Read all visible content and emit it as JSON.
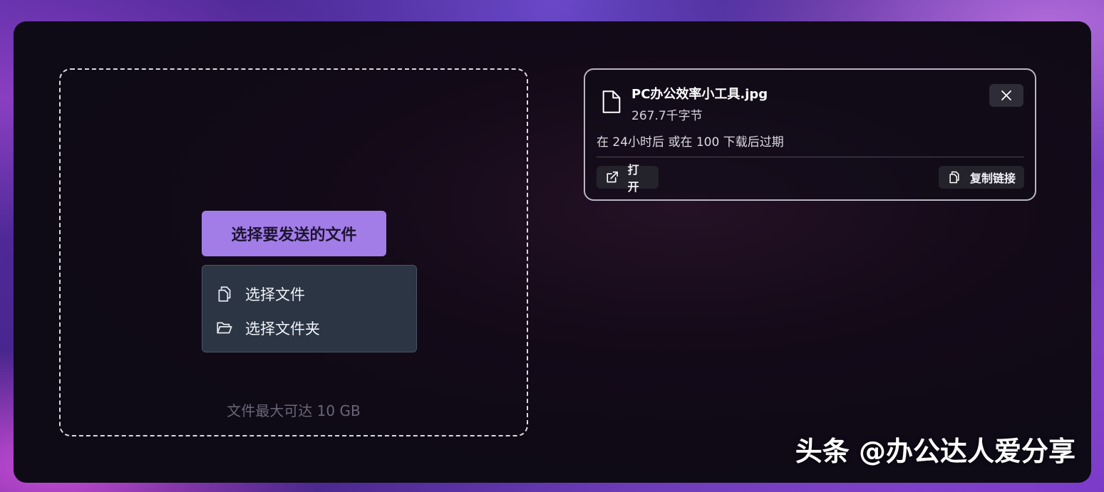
{
  "dropzone": {
    "select_button_label": "选择要发送的文件",
    "menu": [
      {
        "label": "选择文件",
        "icon": "copy-files-icon"
      },
      {
        "label": "选择文件夹",
        "icon": "folder-open-icon"
      }
    ],
    "max_size_text": "文件最大可达 10 GB"
  },
  "file_card": {
    "file_name": "PC办公效率小工具.jpg",
    "file_size": "267.7千字节",
    "expiry_text": "在 24小时后 或在 100 下载后过期",
    "open_label": "打开",
    "copy_label": "复制链接"
  },
  "watermark": "头条 @办公达人爱分享",
  "colors": {
    "accent": "#a27de8",
    "menu_bg": "#2b3544",
    "panel_bg": "#0f0c17"
  }
}
